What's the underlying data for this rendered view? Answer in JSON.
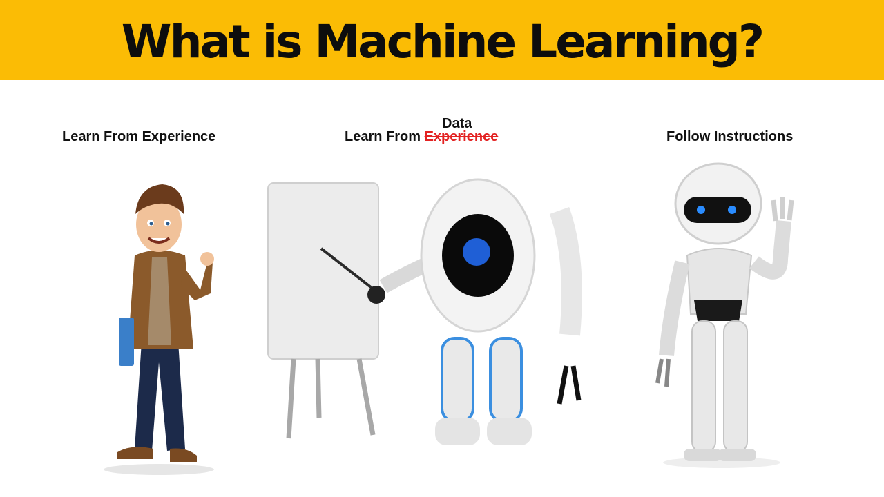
{
  "header": {
    "title": "What is Machine Learning?",
    "background_color": "#fbbc05"
  },
  "panels": [
    {
      "caption": "Learn From Experience",
      "illustration": "human-character-thumbs-up"
    },
    {
      "caption_prefix": "Learn From",
      "caption_struck": "Experience",
      "caption_replacement": "Data",
      "illustration": "robot-teaching-at-whiteboard"
    },
    {
      "caption": "Follow Instructions",
      "illustration": "humanoid-robot-waving"
    }
  ]
}
